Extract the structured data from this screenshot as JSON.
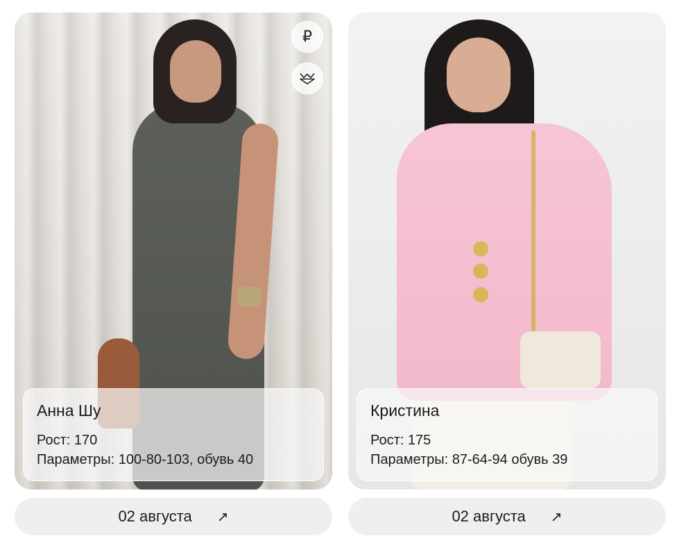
{
  "cards": [
    {
      "name": "Анна Шу",
      "height_line": "Рост: 170",
      "params_line": "Параметры: 100-80-103, обувь 40",
      "date_label": "02 августа",
      "arrow": "↗",
      "icons": [
        "ruble-icon",
        "swimwear-icon"
      ]
    },
    {
      "name": "Кристина",
      "height_line": "Рост: 175",
      "params_line": "Параметры: 87-64-94 обувь 39",
      "date_label": "02 августа",
      "arrow": "↗"
    }
  ],
  "icons": {
    "ruble": "₽",
    "swimwear": "⩘"
  },
  "colors": {
    "panel": "#f8f8f8",
    "date_button": "#efefed",
    "dress": "#4f524c",
    "jacket": "#f3b9cb"
  }
}
